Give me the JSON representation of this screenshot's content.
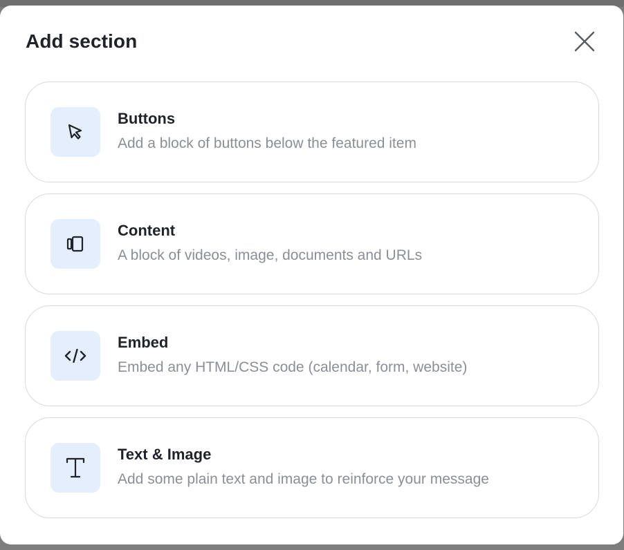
{
  "modal": {
    "title": "Add section",
    "close_icon": "close-icon"
  },
  "options": [
    {
      "id": "buttons",
      "icon": "cursor-pointer-icon",
      "title": "Buttons",
      "description": "Add a block of buttons below the featured item"
    },
    {
      "id": "content",
      "icon": "content-stack-icon",
      "title": "Content",
      "description": "A block of videos, image, documents and URLs"
    },
    {
      "id": "embed",
      "icon": "code-icon",
      "title": "Embed",
      "description": "Embed any HTML/CSS code (calendar, form, website)"
    },
    {
      "id": "text-image",
      "icon": "text-icon",
      "title": "Text & Image",
      "description": "Add some plain text and image to reinforce your message"
    }
  ],
  "colors": {
    "icon_tile": "#e5eefc",
    "title_text": "#1f2328",
    "description_text": "#8a8f96",
    "card_border": "#d6d9de"
  }
}
